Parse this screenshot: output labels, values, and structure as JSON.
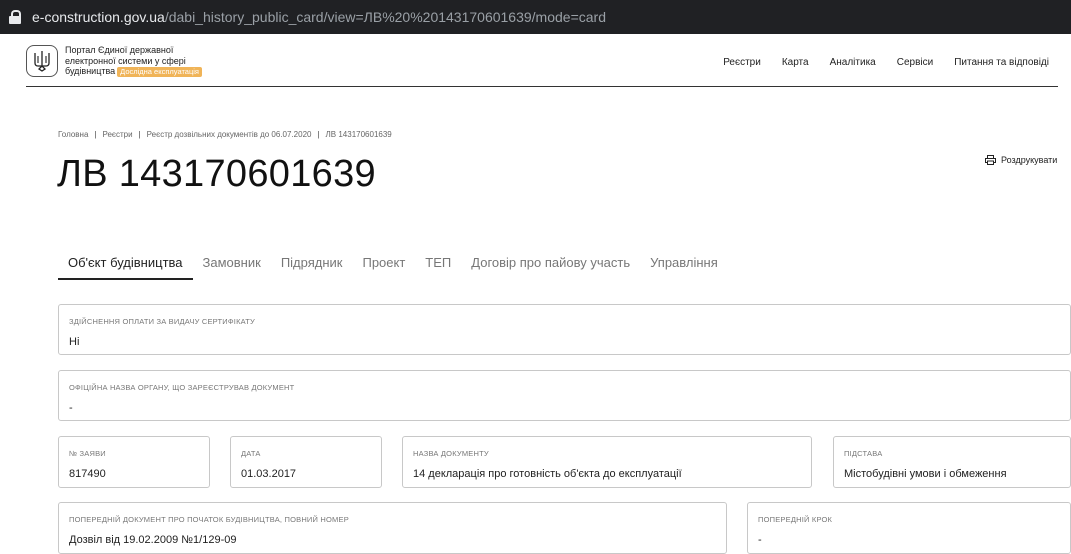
{
  "browser": {
    "url_domain": "e-construction.gov.ua",
    "url_path": "/dabi_history_public_card/view=ЛВ%20%20143170601639/mode=card"
  },
  "header": {
    "portal_line1": "Портал Єдиної державної",
    "portal_line2": "електронної системи у сфері",
    "portal_line3": "будівництва",
    "badge": "Дослідна експлуатація",
    "nav": [
      "Реєстри",
      "Карта",
      "Аналітика",
      "Сервіси",
      "Питання та відповіді"
    ]
  },
  "breadcrumbs": [
    "Головна",
    "Реєстри",
    "Реєстр дозвільних документів до 06.07.2020",
    "ЛВ 143170601639"
  ],
  "page_title": "ЛВ 143170601639",
  "print_label": "Роздрукувати",
  "tabs": [
    "Об'єкт будівництва",
    "Замовник",
    "Підрядник",
    "Проект",
    "ТЕП",
    "Договір про пайову участь",
    "Управління"
  ],
  "fields": {
    "payment": {
      "label": "Здійснення оплати за видачу сертифікату",
      "value": "Ні"
    },
    "authority": {
      "label": "Офіційна назва органу, що зареєстрував документ",
      "value": "-"
    },
    "application_no": {
      "label": "№ заяви",
      "value": "817490"
    },
    "date": {
      "label": "Дата",
      "value": "01.03.2017"
    },
    "doc_name": {
      "label": "Назва документу",
      "value": "14 декларація про готовність об'єкта до експлуатації"
    },
    "basis": {
      "label": "Підстава",
      "value": "Містобудівні умови і обмеження"
    },
    "prev_doc": {
      "label": "Попередній документ про початок будівництва, повний номер",
      "value": "Дозвіл від 19.02.2009 №1/129-09"
    },
    "prev_step": {
      "label": "Попередній крок",
      "value": "-"
    }
  }
}
